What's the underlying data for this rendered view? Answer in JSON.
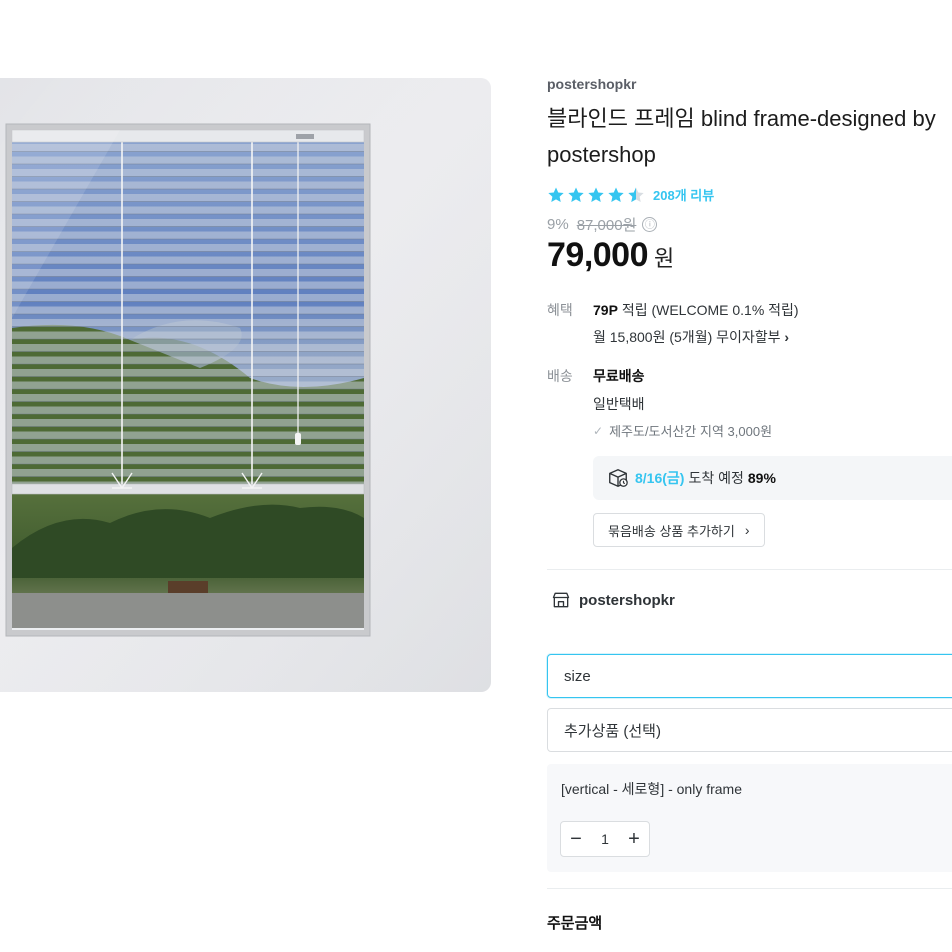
{
  "product": {
    "brand": "postershopkr",
    "title": "블라인드 프레임 blind frame-designed by postershop",
    "rating_stars": 4.5,
    "review_count_label": "208개 리뷰",
    "discount_percent": "9%",
    "original_price": "87,000원",
    "info_icon": "ⓘ",
    "price": "79,000",
    "price_unit": "원"
  },
  "benefit": {
    "label": "혜택",
    "points_bold": "79P",
    "points_text": "적립 (WELCOME 0.1% 적립)",
    "installment": "월 15,800원 (5개월) 무이자할부",
    "installment_chevron": "›"
  },
  "shipping": {
    "label": "배송",
    "free_label": "무료배송",
    "method": "일반택배",
    "jeju_note": "제주도/도서산간 지역 3,000원",
    "arrival_date": "8/16(금)",
    "arrival_text": "도착 예정",
    "arrival_percent": "89%",
    "bundle_button": "묶음배송 상품 추가하기",
    "bundle_chevron": "›"
  },
  "store": {
    "name": "postershopkr"
  },
  "options": {
    "size_placeholder": "size",
    "extra_placeholder": "추가상품 (선택)",
    "selected_option": "[vertical - 세로형] - only frame",
    "quantity": "1",
    "minus": "−",
    "plus": "+"
  },
  "order": {
    "total_label": "주문금액"
  },
  "colors": {
    "accent": "#35c5f0",
    "text": "#2f3438",
    "muted": "#9aa0a6"
  },
  "icons": {
    "star": "star-icon",
    "half_star": "star-half-icon",
    "check": "check-icon",
    "box": "delivery-box-icon",
    "store": "store-icon"
  }
}
